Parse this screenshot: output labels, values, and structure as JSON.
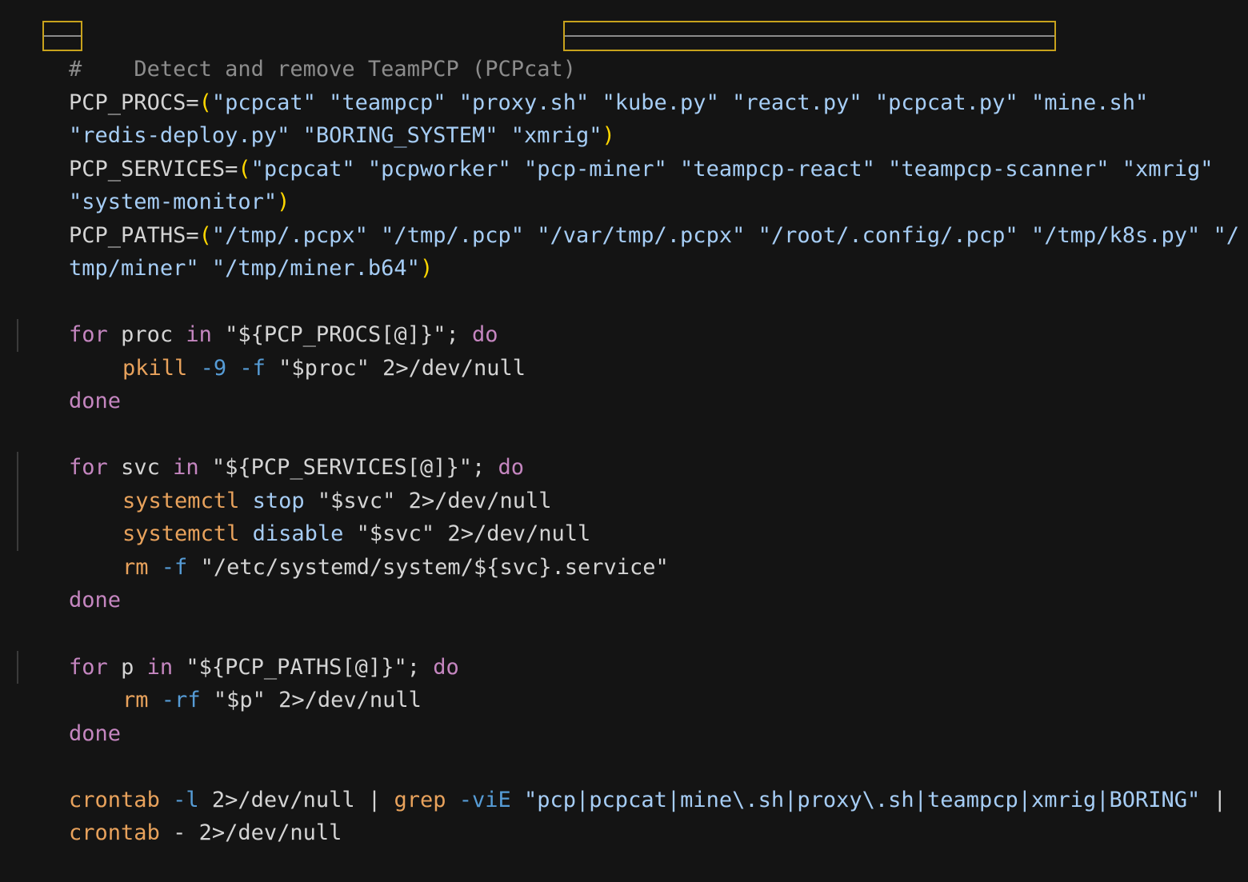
{
  "comment": {
    "hash": "#",
    "text": "Detect and remove TeamPCP (PCPcat)"
  },
  "colors": {
    "background": "#141414",
    "comment": "#8c8c8c",
    "variable": "#d4d4d4",
    "paren": "#ffd700",
    "string": "#a6cdf5",
    "keyword": "#c586c0",
    "command": "#e8a25c",
    "flag": "#569cd6",
    "highlight_border": "#c8a21c"
  },
  "arrays": {
    "procs_line1": {
      "name": "PCP_PROCS=",
      "open": "(",
      "values": "\"pcpcat\" \"teampcp\" \"proxy.sh\" \"kube.py\" \"react.py\" \"pcpcat.py\" \"mine.sh\""
    },
    "procs_line2": {
      "values": "\"redis-deploy.py\" \"BORING_SYSTEM\" \"xmrig\"",
      "close": ")"
    },
    "services_line1": {
      "name": "PCP_SERVICES=",
      "open": "(",
      "values": "\"pcpcat\" \"pcpworker\" \"pcp-miner\" \"teampcp-react\" \"teampcp-scanner\" \"xmrig\""
    },
    "services_line2": {
      "values": "\"system-monitor\"",
      "close": ")"
    },
    "paths_line1": {
      "name": "PCP_PATHS=",
      "open": "(",
      "values": "\"/tmp/.pcpx\" \"/tmp/.pcp\" \"/var/tmp/.pcpx\" \"/root/.config/.pcp\" \"/tmp/k8s.py\" \"/"
    },
    "paths_line2": {
      "values": "tmp/miner\" \"/tmp/miner.b64\"",
      "close": ")"
    }
  },
  "loops": {
    "procs": {
      "for": "for",
      "var": " proc ",
      "in": "in",
      "iter": " \"${PCP_PROCS[@]}\"; ",
      "do": "do",
      "body": [
        {
          "cmd": "pkill",
          "flag": " -9 -f",
          "rest": " \"$proc\" 2>/dev/null"
        }
      ],
      "done": "done"
    },
    "services": {
      "for": "for",
      "var": " svc ",
      "in": "in",
      "iter": " \"${PCP_SERVICES[@]}\"; ",
      "do": "do",
      "body": [
        {
          "cmd": "systemctl",
          "flag": " stop",
          "rest": " \"$svc\" 2>/dev/null"
        },
        {
          "cmd": "systemctl",
          "flag": " disable",
          "rest": " \"$svc\" 2>/dev/null"
        },
        {
          "cmd": "rm",
          "flag": " -f",
          "rest": " \"/etc/systemd/system/${svc}.service\""
        }
      ],
      "done": "done"
    },
    "paths": {
      "for": "for",
      "var": " p ",
      "in": "in",
      "iter": " \"${PCP_PATHS[@]}\"; ",
      "do": "do",
      "body": [
        {
          "cmd": "rm",
          "flag": " -rf",
          "rest": " \"$p\" 2>/dev/null"
        }
      ],
      "done": "done"
    }
  },
  "crontab": {
    "line1": {
      "cmd": "crontab",
      "flag": " -l",
      "rest1": " 2>/dev/null | ",
      "cmd2": "grep",
      "flag2": " -viE",
      "pattern": " \"pcp|pcpcat|mine\\.sh|proxy\\.sh|teampcp|xmrig|BORING\"",
      "pipe": " |"
    },
    "line2": {
      "cmd": "crontab",
      "rest": " - 2>/dev/null"
    }
  }
}
